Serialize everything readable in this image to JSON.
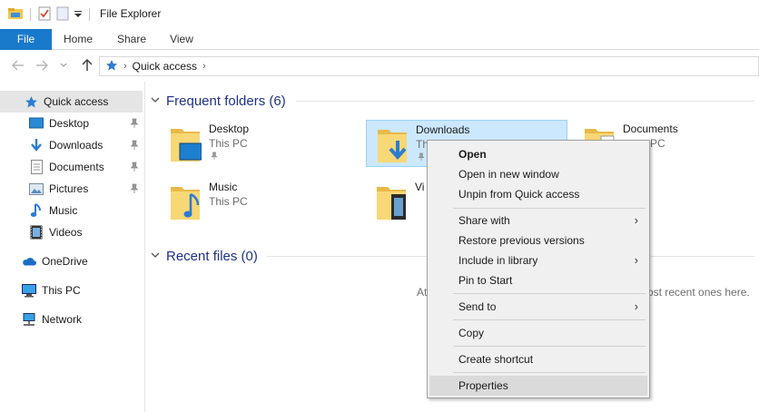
{
  "window": {
    "title": "File Explorer"
  },
  "ribbon": {
    "tabs": [
      "File",
      "Home",
      "Share",
      "View"
    ]
  },
  "address": {
    "crumbs": [
      "Quick access"
    ]
  },
  "nav": {
    "quick_access": "Quick access",
    "items": [
      "Desktop",
      "Downloads",
      "Documents",
      "Pictures",
      "Music",
      "Videos"
    ],
    "onedrive": "OneDrive",
    "thispc": "This PC",
    "network": "Network"
  },
  "content": {
    "frequent_header": "Frequent folders (6)",
    "recent_header": "Recent files (0)",
    "folders": [
      {
        "name": "Desktop",
        "location": "This PC"
      },
      {
        "name": "Downloads",
        "location": "Th"
      },
      {
        "name": "Documents",
        "location": "PC"
      },
      {
        "name": "Music",
        "location": "This PC"
      },
      {
        "name": "Vi",
        "location": ""
      }
    ],
    "empty_left": "At",
    "empty_right": "ost recent ones here."
  },
  "context_menu": {
    "items": [
      "Open",
      "Open in new window",
      "Unpin from Quick access",
      "Share with",
      "Restore previous versions",
      "Include in library",
      "Pin to Start",
      "Send to",
      "Copy",
      "Create shortcut",
      "Properties"
    ]
  },
  "colors": {
    "accent": "#1979ca",
    "folder": "#f8d775",
    "header": "#1e3287"
  }
}
